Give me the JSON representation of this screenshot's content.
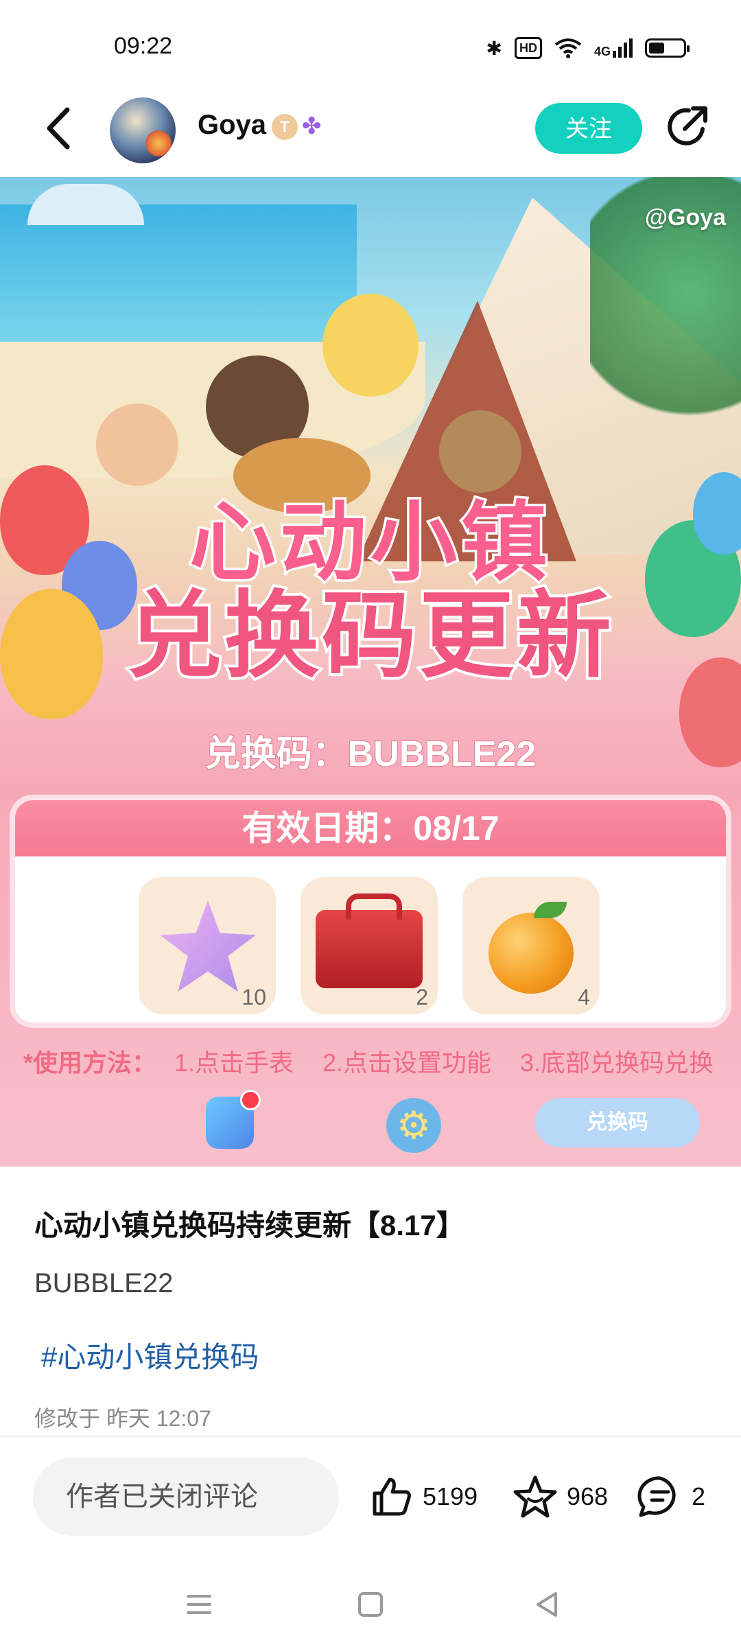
{
  "status_bar": {
    "time": "09:22",
    "network_label": "4G",
    "hd_label": "HD"
  },
  "header": {
    "back_icon": "chevron-left-icon",
    "user_name": "Goya",
    "level_badge": "T",
    "follow_label": "关注",
    "share_icon": "share-icon"
  },
  "banner": {
    "watermark": "@Goya",
    "title_line1": "心动小镇",
    "title_line2": "兑换码更新",
    "code_line": "兑换码：BUBBLE22",
    "validity": "有效日期：08/17",
    "rewards": [
      {
        "icon": "star-icon",
        "qty": "10"
      },
      {
        "icon": "toolbox-icon",
        "qty": "2"
      },
      {
        "icon": "orange-icon",
        "qty": "4"
      }
    ],
    "usage_label": "*使用方法：",
    "steps": [
      "1.点击手表",
      "2.点击设置功能",
      "3.底部兑换码兑换"
    ],
    "redeem_button": "兑换码"
  },
  "post": {
    "title": "心动小镇兑换码持续更新【8.17】",
    "text": "BUBBLE22",
    "tag": "#心动小镇兑换码",
    "modified": "修改于 昨天 12:07"
  },
  "bottom_bar": {
    "comment_placeholder": "作者已关闭评论",
    "likes": "5199",
    "favorites": "968",
    "comments": "2"
  },
  "colors": {
    "accent": "#14d1bf",
    "tag_blue": "#1f5fa8",
    "banner_pink": "#f37a91"
  }
}
